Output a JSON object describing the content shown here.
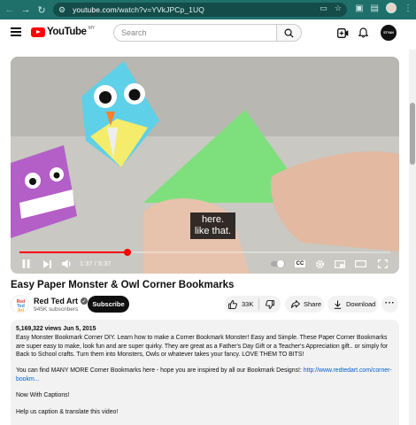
{
  "browser": {
    "url_host": "youtube.com",
    "url_path": "/watch?v=YVkJPCp_1UQ"
  },
  "header": {
    "logo_text": "YouTube",
    "logo_suffix": "MY",
    "search_placeholder": "Search",
    "avatar_text": "STYAN"
  },
  "video": {
    "caption_line1": "here.",
    "caption_line2": "like that.",
    "time_current": "1:37",
    "time_total": "5:37",
    "progress": 0.29,
    "cc_label": "CC"
  },
  "info": {
    "title": "Easy Paper Monster & Owl Corner Bookmarks",
    "channel_name": "Red Ted Art",
    "channel_logo_text": "Red Ted Art",
    "subscribers": "945K subscribers",
    "subscribe_label": "Subscribe",
    "likes": "33K",
    "share_label": "Share",
    "download_label": "Download"
  },
  "description": {
    "views_date": "5,169,322 views  Jun 5, 2015",
    "para1": "Easy Monster Bookmark Corner DIY. Learn how to make a Corner Bookmark Monster! Easy and Simple. These Paper Corner Bookmarks are super easy to make, look fun and are super quirky. They are great as a Father's Day Gift or a Teacher's Appreciation gift.. or simply for Back to School crafts.  Turn them into Monsters, Owls or whatever takes your fancy. LOVE THEM TO BITS!",
    "para2_text": "You can find MANY MORE Corner Bookmarks here - hope you are inspired by all our Bookmark Designs!: ",
    "para2_link": "http://www.redtedart.com/corner-bookm...",
    "para3": "Now With Captions!",
    "para4": "Help us caption & translate this video!"
  },
  "colors": {
    "chrome_bar": "#1f6f6b",
    "accent_red": "#ff0000",
    "link_blue": "#065fd4"
  },
  "icons": [
    "back-icon",
    "forward-icon",
    "reload-icon",
    "tune-icon",
    "cast-icon",
    "star-icon",
    "extensions-icon",
    "menu-icon",
    "search-icon",
    "create-icon",
    "bell-icon",
    "play-pause-icon",
    "next-icon",
    "volume-icon",
    "autoplay-toggle",
    "settings-icon",
    "miniplayer-icon",
    "theater-icon",
    "fullscreen-icon",
    "like-icon",
    "dislike-icon",
    "share-icon",
    "download-icon",
    "more-icon"
  ]
}
